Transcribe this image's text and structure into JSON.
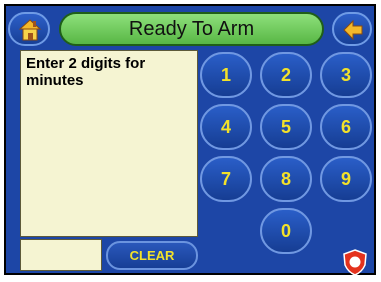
{
  "header": {
    "home_icon": "home-icon",
    "title": "Ready To Arm",
    "back_icon": "back-arrow-icon"
  },
  "message": {
    "text": "Enter 2 digits for minutes"
  },
  "entry": {
    "value": ""
  },
  "keypad": {
    "keys": [
      "1",
      "2",
      "3",
      "4",
      "5",
      "6",
      "7",
      "8",
      "9",
      "0"
    ],
    "clear_label": "CLEAR"
  },
  "footer": {
    "alert_icon": "emergency-shield-icon"
  },
  "colors": {
    "panel": "#1d46a6",
    "title_bar": "#6bc858",
    "key_text": "#f2e12a",
    "message_bg": "#f5f4d2",
    "alert": "#e4321d"
  }
}
